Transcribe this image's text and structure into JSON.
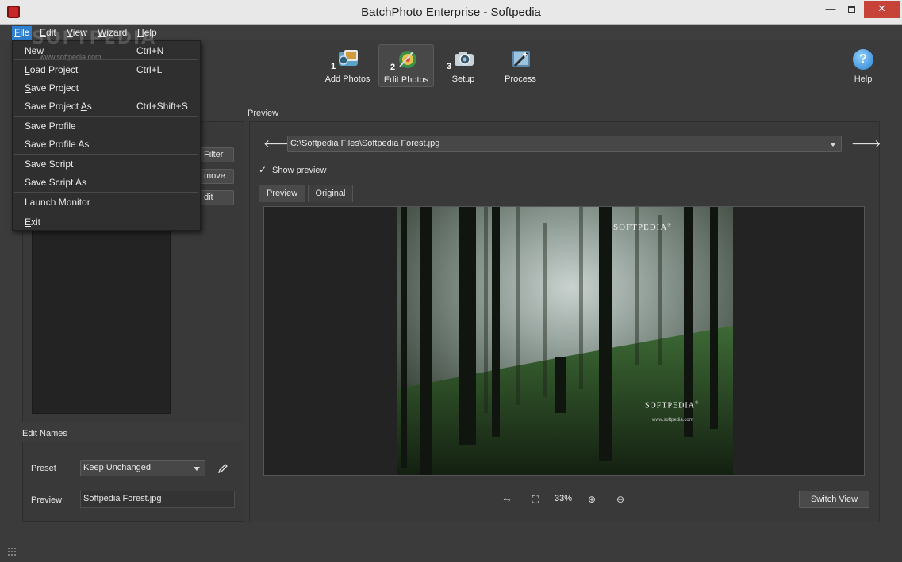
{
  "window": {
    "title": "BatchPhoto Enterprise - Softpedia"
  },
  "menu": {
    "items": [
      {
        "key": "file",
        "label": "File",
        "mnemonic": "F"
      },
      {
        "key": "edit",
        "label": "Edit",
        "mnemonic": "E"
      },
      {
        "key": "view",
        "label": "View",
        "mnemonic": "V"
      },
      {
        "key": "wizard",
        "label": "Wizard",
        "mnemonic": "W"
      },
      {
        "key": "help",
        "label": "Help",
        "mnemonic": "H"
      }
    ],
    "active": "File"
  },
  "watermark": {
    "logo": "SOFTPEDIA",
    "url": "www.softpedia.com"
  },
  "file_menu": [
    {
      "label": "New",
      "shortcut": "Ctrl+N"
    },
    {
      "label": "Load Project",
      "shortcut": "Ctrl+L"
    },
    {
      "label": "Save Project",
      "shortcut": ""
    },
    {
      "label": "Save Project As",
      "shortcut": "Ctrl+Shift+S"
    },
    {
      "label": "Save Profile",
      "shortcut": ""
    },
    {
      "label": "Save Profile As",
      "shortcut": ""
    },
    {
      "label": "Save Script",
      "shortcut": ""
    },
    {
      "label": "Save Script As",
      "shortcut": ""
    },
    {
      "label": "Launch Monitor",
      "shortcut": ""
    },
    {
      "label": "Exit",
      "shortcut": ""
    }
  ],
  "toolbar": {
    "steps": [
      {
        "number": "1",
        "label": "Add Photos",
        "icon": "add-photos-icon"
      },
      {
        "number": "2",
        "label": "Edit Photos",
        "icon": "edit-photos-icon",
        "selected": true
      },
      {
        "number": "3",
        "label": "Setup",
        "icon": "setup-camera-icon"
      },
      {
        "number": "",
        "label": "Process",
        "icon": "process-wand-icon"
      }
    ],
    "help_label": "Help"
  },
  "left_panel": {
    "buttons": [
      "Filter",
      "move",
      "dit"
    ],
    "edit_names": {
      "title": "Edit Names",
      "preset_label": "Preset",
      "preset_value": "Keep Unchanged",
      "preview_label": "Preview",
      "preview_value": "Softpedia Forest.jpg"
    }
  },
  "preview": {
    "section_title": "Preview",
    "file_path": "C:\\Softpedia Files\\Softpedia Forest.jpg",
    "show_preview_label": "Show preview",
    "show_preview_checked": true,
    "tabs": [
      "Preview",
      "Original"
    ],
    "active_tab": "Preview",
    "image_watermark": "SOFTPEDIA",
    "image_watermark_sup": "®",
    "image_watermark_url": "www.softpedia.com",
    "zoom_level": "33%",
    "switch_view_label": "Switch View"
  }
}
